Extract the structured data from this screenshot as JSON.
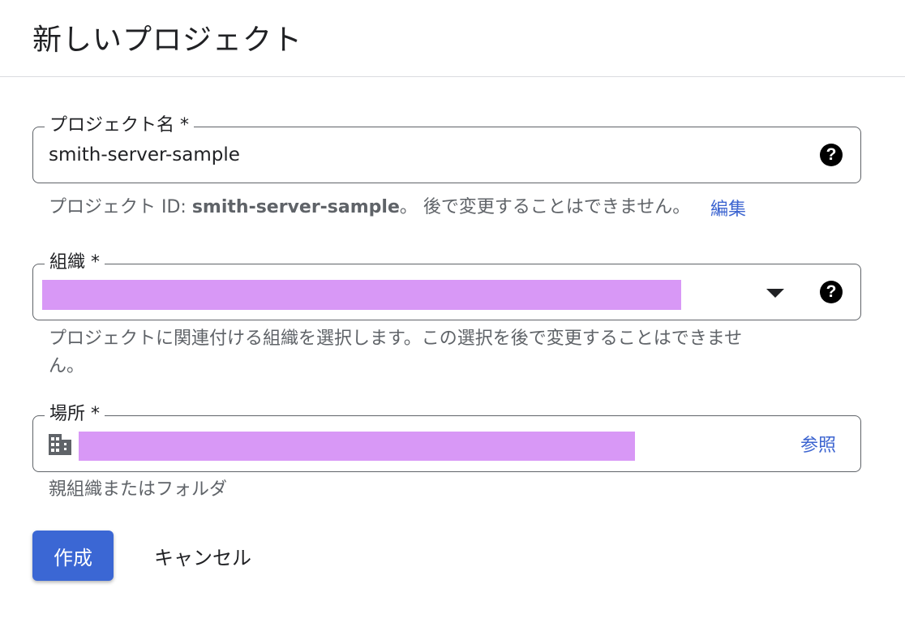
{
  "header": {
    "title": "新しいプロジェクト"
  },
  "project_name": {
    "label": "プロジェクト名 *",
    "value": "smith-server-sample",
    "help_icon": "help-circle-icon"
  },
  "project_id_hint": {
    "prefix": "プロジェクト ID: ",
    "project_id": "smith-server-sample",
    "suffix": "。 後で変更することはできません。",
    "edit_label": "編集"
  },
  "organization": {
    "label": "組織 *",
    "dropdown_icon": "arrow-drop-down-icon",
    "help_icon": "help-circle-icon",
    "hint": "プロジェクトに関連付ける組織を選択します。この選択を後で変更することはできませ",
    "hint_line2": "ん。"
  },
  "location": {
    "label": "場所 *",
    "icon": "building-icon",
    "browse_label": "参照",
    "hint": "親組織またはフォルダ"
  },
  "actions": {
    "create_label": "作成",
    "cancel_label": "キャンセル"
  },
  "colors": {
    "primary": "#3b67d4",
    "link": "#3c64d0",
    "redaction": "#d898f6",
    "border": "#5f6368"
  }
}
